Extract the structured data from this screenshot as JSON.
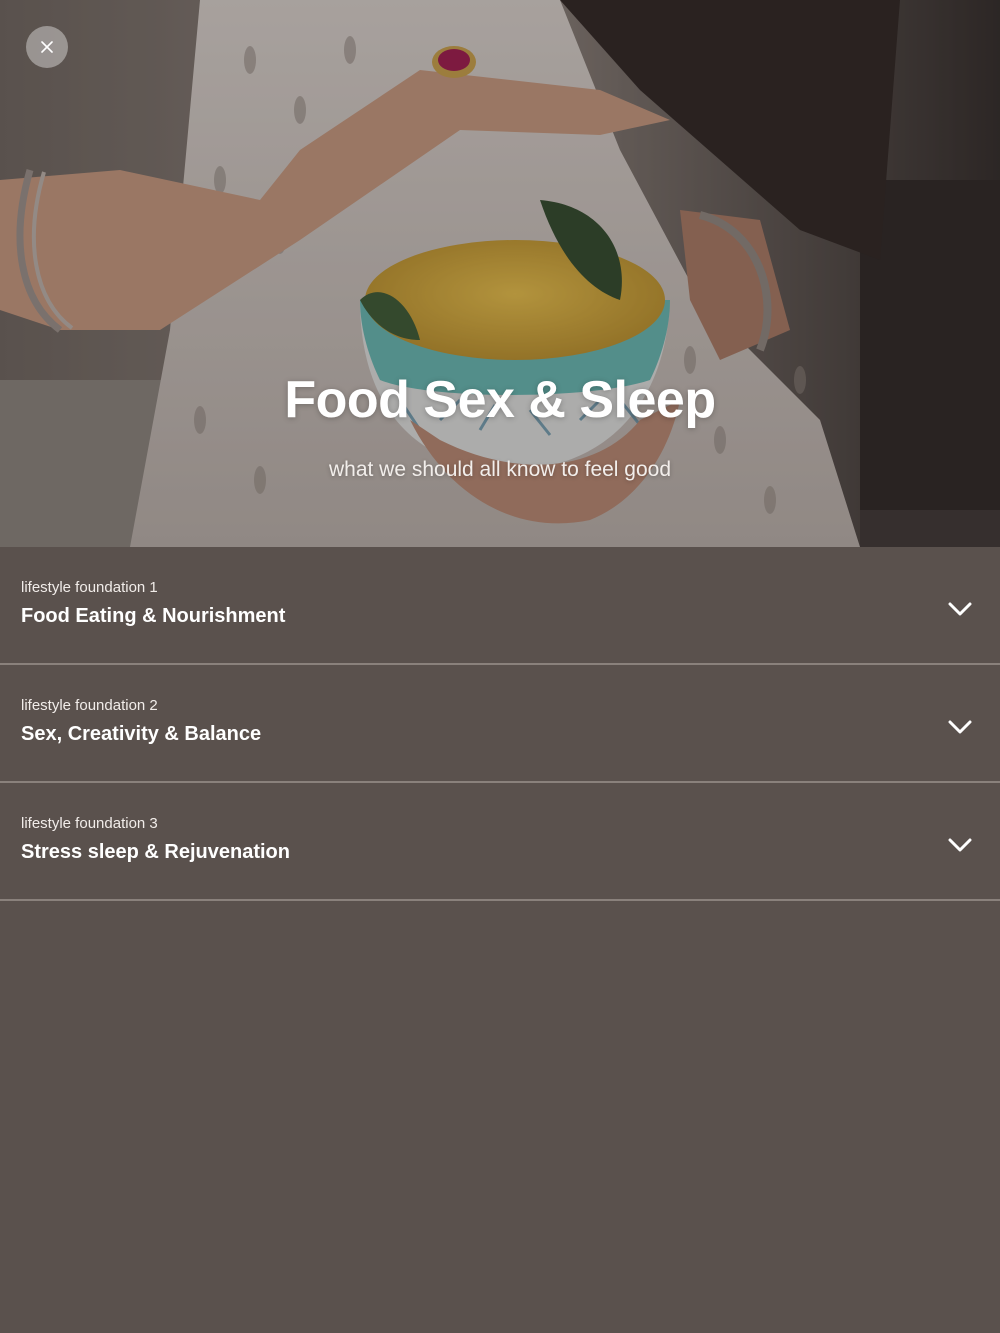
{
  "hero": {
    "title": "Food Sex & Sleep",
    "subtitle": "what we should all know to feel good",
    "close_icon": "close-icon"
  },
  "foundations": [
    {
      "kicker": "lifestyle foundation 1",
      "title": "Food Eating & Nourishment"
    },
    {
      "kicker": "lifestyle foundation 2",
      "title": "Sex, Creativity & Balance"
    },
    {
      "kicker": "lifestyle foundation 3",
      "title": "Stress sleep & Rejuvenation"
    }
  ],
  "colors": {
    "background": "#5a514d",
    "divider": "#8a817c",
    "text": "#ffffff"
  },
  "icons": {
    "expand": "chevron-down-icon"
  }
}
